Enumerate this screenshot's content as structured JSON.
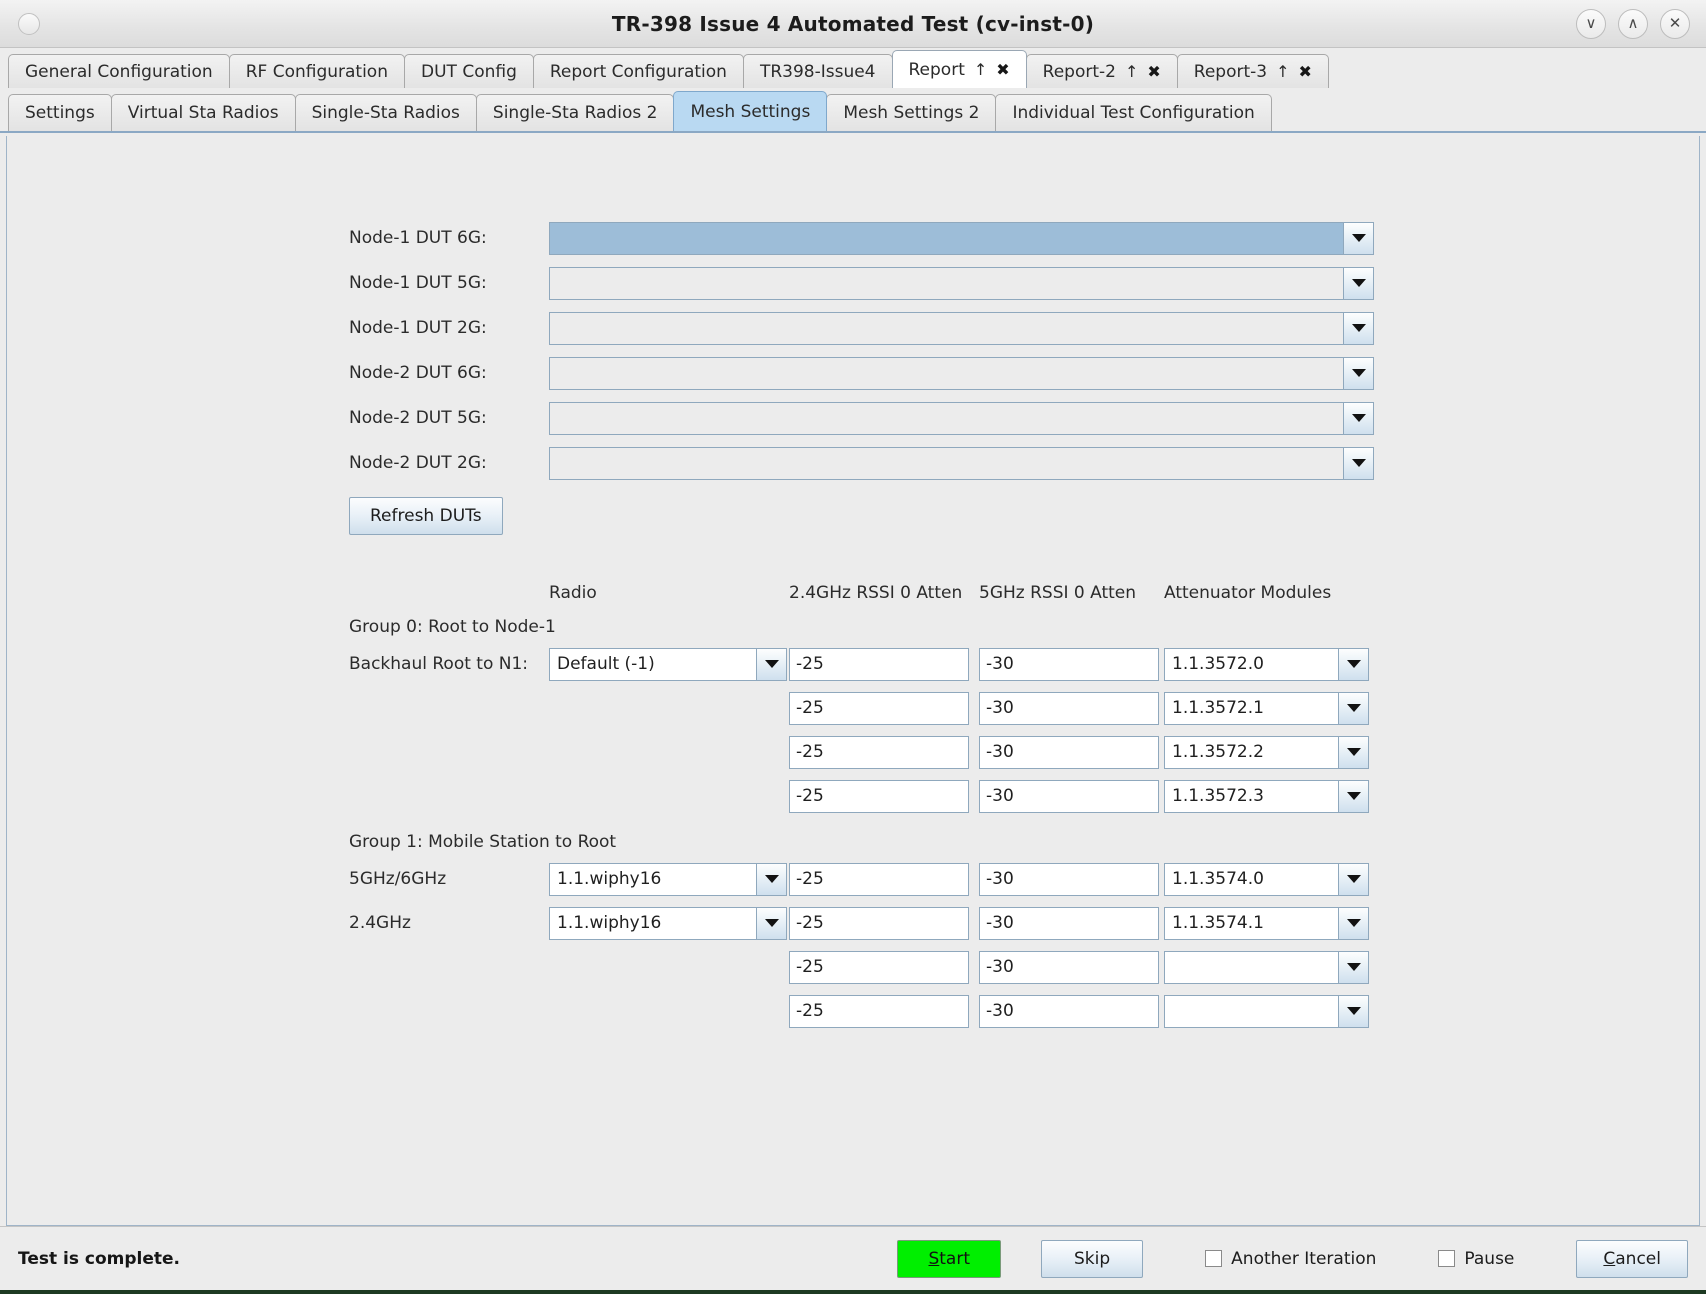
{
  "window": {
    "title": "TR-398 Issue 4 Automated Test  (cv-inst-0)",
    "controls": {
      "minimize": "∨",
      "maximize": "∧",
      "close": "✕"
    }
  },
  "tabs_primary": [
    {
      "label": "General Configuration",
      "active": false
    },
    {
      "label": "RF Configuration",
      "active": false
    },
    {
      "label": "DUT Config",
      "active": false
    },
    {
      "label": "Report Configuration",
      "active": false
    },
    {
      "label": "TR398-Issue4",
      "active": false
    },
    {
      "label": "Report",
      "active": true,
      "up": "↑",
      "close": "✖"
    },
    {
      "label": "Report-2",
      "active": false,
      "up": "↑",
      "close": "✖"
    },
    {
      "label": "Report-3",
      "active": false,
      "up": "↑",
      "close": "✖"
    }
  ],
  "tabs_secondary": [
    {
      "label": "Settings",
      "active": false
    },
    {
      "label": "Virtual Sta Radios",
      "active": false
    },
    {
      "label": "Single-Sta Radios",
      "active": false
    },
    {
      "label": "Single-Sta Radios 2",
      "active": false
    },
    {
      "label": "Mesh Settings",
      "active": true
    },
    {
      "label": "Mesh Settings 2",
      "active": false
    },
    {
      "label": "Individual Test Configuration",
      "active": false
    }
  ],
  "dut_selectors": [
    {
      "label": "Node-1 DUT 6G:",
      "value": "",
      "selected": true
    },
    {
      "label": "Node-1 DUT 5G:",
      "value": "",
      "selected": false
    },
    {
      "label": "Node-1 DUT 2G:",
      "value": "",
      "selected": false
    },
    {
      "label": "Node-2 DUT 6G:",
      "value": "",
      "selected": false
    },
    {
      "label": "Node-2 DUT 5G:",
      "value": "",
      "selected": false
    },
    {
      "label": "Node-2 DUT 2G:",
      "value": "",
      "selected": false
    }
  ],
  "refresh_button": "Refresh DUTs",
  "table": {
    "headers": {
      "radio": "Radio",
      "rssi_24": "2.4GHz RSSI 0 Atten",
      "rssi_5": "5GHz RSSI 0 Atten",
      "modules": "Attenuator Modules"
    },
    "groups": [
      {
        "title": "Group 0: Root to Node-1",
        "rows": [
          {
            "label": "Backhaul Root to N1:",
            "radio": "Default (-1)",
            "has_radio": true,
            "rssi_24": "-25",
            "rssi_5": "-30",
            "module": "1.1.3572.0"
          },
          {
            "label": "",
            "radio": "",
            "has_radio": false,
            "rssi_24": "-25",
            "rssi_5": "-30",
            "module": "1.1.3572.1"
          },
          {
            "label": "",
            "radio": "",
            "has_radio": false,
            "rssi_24": "-25",
            "rssi_5": "-30",
            "module": "1.1.3572.2"
          },
          {
            "label": "",
            "radio": "",
            "has_radio": false,
            "rssi_24": "-25",
            "rssi_5": "-30",
            "module": "1.1.3572.3"
          }
        ]
      },
      {
        "title": "Group 1: Mobile Station to Root",
        "rows": [
          {
            "label": "5GHz/6GHz",
            "radio": "1.1.wiphy16",
            "has_radio": true,
            "rssi_24": "-25",
            "rssi_5": "-30",
            "module": "1.1.3574.0"
          },
          {
            "label": "2.4GHz",
            "radio": "1.1.wiphy16",
            "has_radio": true,
            "rssi_24": "-25",
            "rssi_5": "-30",
            "module": "1.1.3574.1"
          },
          {
            "label": "",
            "radio": "",
            "has_radio": false,
            "rssi_24": "-25",
            "rssi_5": "-30",
            "module": ""
          },
          {
            "label": "",
            "radio": "",
            "has_radio": false,
            "rssi_24": "-25",
            "rssi_5": "-30",
            "module": ""
          }
        ]
      }
    ]
  },
  "statusbar": {
    "message": "Test is complete.",
    "start": "Start",
    "skip": "Skip",
    "another_iteration": "Another Iteration",
    "another_iteration_checked": false,
    "pause": "Pause",
    "pause_checked": false,
    "cancel": "Cancel"
  },
  "colors": {
    "start_green": "#00ef00",
    "active_tab_blue": "#b9d9f2",
    "selected_combo_blue": "#9dbdd8"
  }
}
